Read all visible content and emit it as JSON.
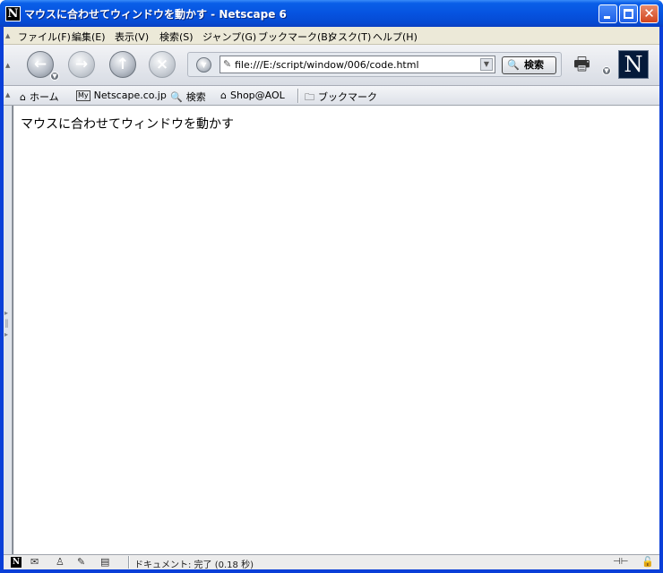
{
  "window": {
    "title": "マウスに合わせてウィンドウを動かす - Netscape 6",
    "app_icon": "N",
    "buttons": {
      "minimize": "minimize-icon",
      "maximize": "maximize-icon",
      "close": "✕"
    }
  },
  "menu": {
    "items": [
      {
        "label": "ファイル(F)"
      },
      {
        "label": "編集(E)"
      },
      {
        "label": "表示(V)"
      },
      {
        "label": "検索(S)"
      },
      {
        "label": "ジャンプ(G)"
      },
      {
        "label": "ブックマーク(B)"
      },
      {
        "label": "タスク(T)"
      },
      {
        "label": "ヘルプ(H)"
      }
    ]
  },
  "navigation": {
    "back_icon": "back-arrow-icon",
    "forward_icon": "forward-arrow-icon",
    "reload_icon": "reload-icon",
    "stop_icon": "stop-icon",
    "url": "file:///E:/script/window/006/code.html",
    "search_label": "検索",
    "print_icon": "printer-icon",
    "logo": "N"
  },
  "personal_toolbar": {
    "items": [
      {
        "label": "ホーム",
        "icon": "home-icon"
      },
      {
        "label": "Netscape.co.jp",
        "icon": "my-icon"
      },
      {
        "label": "検索",
        "icon": "search-icon"
      },
      {
        "label": "Shop@AOL",
        "icon": "shop-icon"
      },
      {
        "label": "ブックマーク",
        "icon": "folder-icon"
      }
    ]
  },
  "page": {
    "text": "マウスに合わせてウィンドウを動かす"
  },
  "status": {
    "text": "ドキュメント: 完了 (0.18 秒)",
    "icons": [
      "netscape-icon",
      "mail-icon",
      "aim-icon",
      "composer-icon",
      "addressbook-icon",
      "online-icon",
      "security-lock-icon"
    ]
  },
  "colors": {
    "titlebar": "#0653e0",
    "chrome": "#ece9d8",
    "content_background": "#ffffff"
  }
}
